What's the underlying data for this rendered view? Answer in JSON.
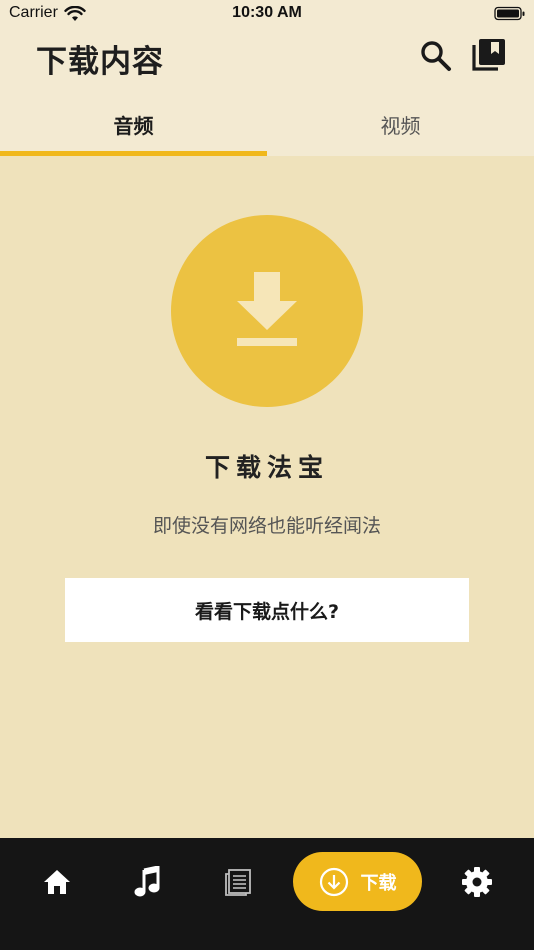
{
  "status_bar": {
    "carrier": "Carrier",
    "time": "10:30 AM",
    "wifi_icon": "wifi-icon",
    "battery_icon": "battery-icon"
  },
  "header": {
    "title": "下载内容",
    "search_icon": "search-icon",
    "library_icon": "library-bookmark-icon"
  },
  "tabs": [
    {
      "label": "音频",
      "active": true
    },
    {
      "label": "视频",
      "active": false
    }
  ],
  "empty_state": {
    "icon": "download-icon",
    "title": "下载法宝",
    "subtitle": "即使没有网络也能听经闻法",
    "cta_label": "看看下载点什么?"
  },
  "bottom_nav": {
    "items": [
      {
        "icon": "home-icon",
        "label": ""
      },
      {
        "icon": "music-note-icon",
        "label": ""
      },
      {
        "icon": "scripture-list-icon",
        "label": ""
      },
      {
        "icon": "download-circle-icon",
        "label": "下载",
        "active": true
      },
      {
        "icon": "gear-icon",
        "label": ""
      }
    ]
  },
  "colors": {
    "background": "#EFE2BB",
    "header_background": "#F3EAD2",
    "accent": "#F0B81C",
    "circle": "#ECC242",
    "nav_background": "#151515"
  }
}
